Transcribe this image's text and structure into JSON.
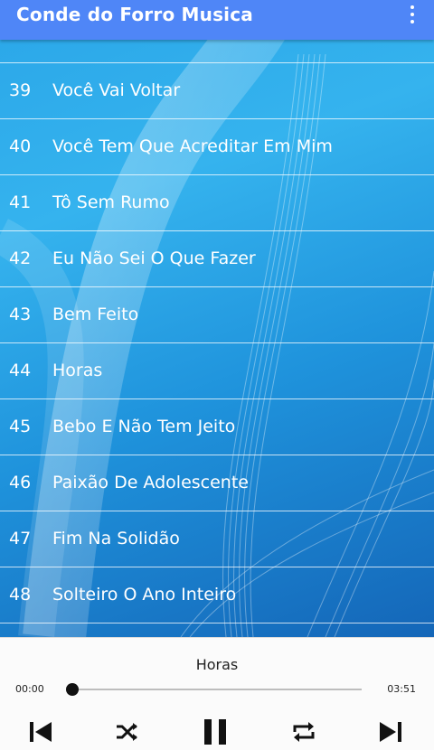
{
  "app": {
    "title": "Conde do Forro Musica"
  },
  "colors": {
    "appbar": "#4f86f7",
    "list_text": "#ffffff",
    "player_bg": "#fbfbfb"
  },
  "songs": [
    {
      "number": "39",
      "title": "Você Vai Voltar"
    },
    {
      "number": "40",
      "title": "Você Tem Que Acreditar Em Mim"
    },
    {
      "number": "41",
      "title": "Tô Sem Rumo"
    },
    {
      "number": "42",
      "title": "Eu Não Sei O Que Fazer"
    },
    {
      "number": "43",
      "title": "Bem Feito"
    },
    {
      "number": "44",
      "title": "Horas"
    },
    {
      "number": "45",
      "title": "Bebo E Não Tem Jeito"
    },
    {
      "number": "46",
      "title": "Paixão De Adolescente"
    },
    {
      "number": "47",
      "title": "Fim Na Solidão"
    },
    {
      "number": "48",
      "title": "Solteiro O Ano Inteiro"
    }
  ],
  "player": {
    "now_playing": "Horas",
    "time_current": "00:00",
    "time_total": "03:51",
    "progress": 0.0,
    "icons": [
      "skip-previous-icon",
      "shuffle-icon",
      "pause-icon",
      "repeat-icon",
      "skip-next-icon"
    ]
  }
}
